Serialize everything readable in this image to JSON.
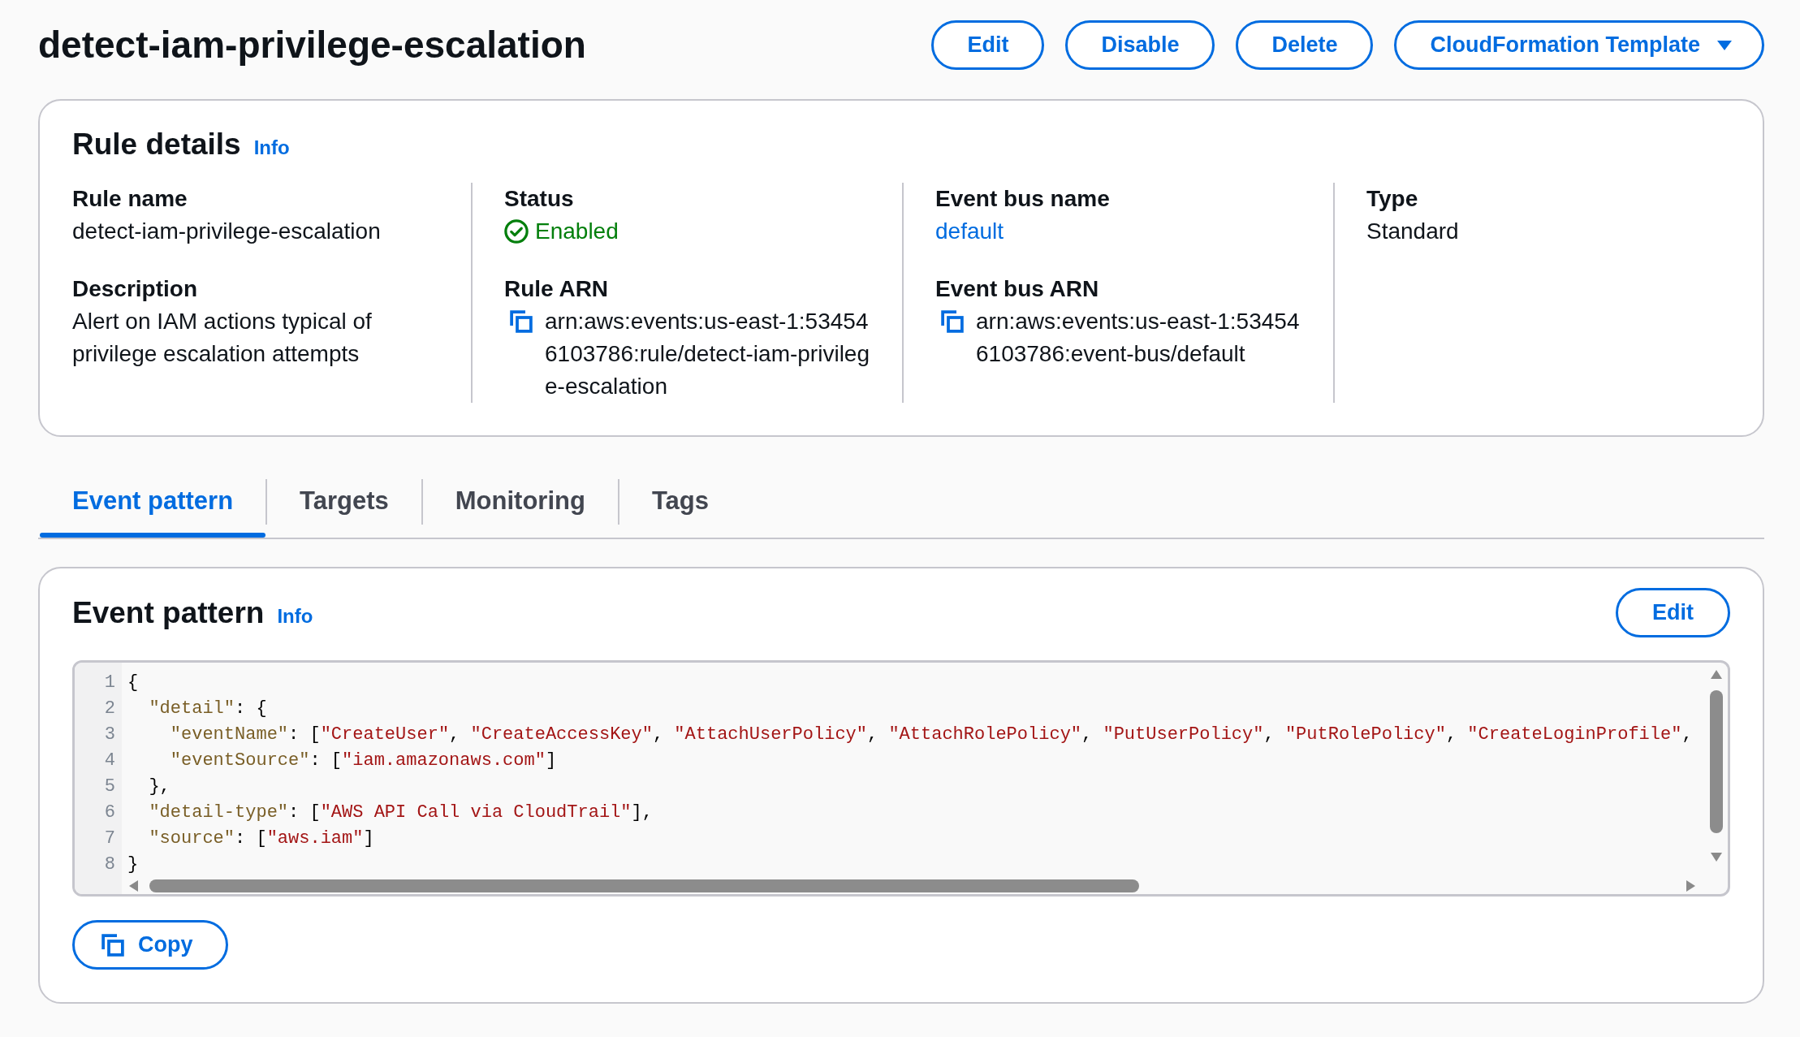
{
  "page": {
    "title": "detect-iam-privilege-escalation",
    "actions": [
      {
        "label": "Edit",
        "kind": "button"
      },
      {
        "label": "Disable",
        "kind": "button"
      },
      {
        "label": "Delete",
        "kind": "button"
      },
      {
        "label": "CloudFormation Template",
        "kind": "dropdown"
      }
    ]
  },
  "rule_details": {
    "heading": "Rule details",
    "info": "Info",
    "columns": [
      {
        "fields": [
          {
            "label": "Rule name",
            "value": "detect-iam-privilege-escalation",
            "kind": "text"
          },
          {
            "label": "Description",
            "value": "Alert on IAM actions typical of privilege escalation attempts",
            "kind": "text"
          }
        ]
      },
      {
        "fields": [
          {
            "label": "Status",
            "value": "Enabled",
            "kind": "status"
          },
          {
            "label": "Rule ARN",
            "value": "arn:aws:events:us-east-1:534546103786:rule/detect-iam-privilege-escalation",
            "kind": "copyable"
          }
        ]
      },
      {
        "fields": [
          {
            "label": "Event bus name",
            "value": "default",
            "kind": "link"
          },
          {
            "label": "Event bus ARN",
            "value": "arn:aws:events:us-east-1:534546103786:event-bus/default",
            "kind": "copyable"
          }
        ]
      },
      {
        "fields": [
          {
            "label": "Type",
            "value": "Standard",
            "kind": "text"
          }
        ]
      }
    ]
  },
  "tabs": [
    {
      "label": "Event pattern",
      "selected": true
    },
    {
      "label": "Targets",
      "selected": false
    },
    {
      "label": "Monitoring",
      "selected": false
    },
    {
      "label": "Tags",
      "selected": false
    }
  ],
  "event_pattern": {
    "heading": "Event pattern",
    "info": "Info",
    "edit_button": "Edit",
    "code_lines": [
      {
        "number": "1",
        "tokens": [
          {
            "kind": "punct",
            "text": "{"
          }
        ]
      },
      {
        "number": "2",
        "tokens": [
          {
            "kind": "key",
            "text": "  \"detail\""
          },
          {
            "kind": "punct",
            "text": ": {"
          }
        ]
      },
      {
        "number": "3",
        "tokens": [
          {
            "kind": "key",
            "text": "    \"eventName\""
          },
          {
            "kind": "punct",
            "text": ": ["
          },
          {
            "kind": "string",
            "text": "\"CreateUser\""
          },
          {
            "kind": "punct",
            "text": ", "
          },
          {
            "kind": "string",
            "text": "\"CreateAccessKey\""
          },
          {
            "kind": "punct",
            "text": ", "
          },
          {
            "kind": "string",
            "text": "\"AttachUserPolicy\""
          },
          {
            "kind": "punct",
            "text": ", "
          },
          {
            "kind": "string",
            "text": "\"AttachRolePolicy\""
          },
          {
            "kind": "punct",
            "text": ", "
          },
          {
            "kind": "string",
            "text": "\"PutUserPolicy\""
          },
          {
            "kind": "punct",
            "text": ", "
          },
          {
            "kind": "string",
            "text": "\"PutRolePolicy\""
          },
          {
            "kind": "punct",
            "text": ", "
          },
          {
            "kind": "string",
            "text": "\"CreateLoginProfile\""
          },
          {
            "kind": "punct",
            "text": ","
          }
        ]
      },
      {
        "number": "4",
        "tokens": [
          {
            "kind": "key",
            "text": "    \"eventSource\""
          },
          {
            "kind": "punct",
            "text": ": ["
          },
          {
            "kind": "string",
            "text": "\"iam.amazonaws.com\""
          },
          {
            "kind": "punct",
            "text": "]"
          }
        ]
      },
      {
        "number": "5",
        "tokens": [
          {
            "kind": "punct",
            "text": "  },"
          }
        ]
      },
      {
        "number": "6",
        "tokens": [
          {
            "kind": "key",
            "text": "  \"detail-type\""
          },
          {
            "kind": "punct",
            "text": ": ["
          },
          {
            "kind": "string",
            "text": "\"AWS API Call via CloudTrail\""
          },
          {
            "kind": "punct",
            "text": "],"
          }
        ]
      },
      {
        "number": "7",
        "tokens": [
          {
            "kind": "key",
            "text": "  \"source\""
          },
          {
            "kind": "punct",
            "text": ": ["
          },
          {
            "kind": "string",
            "text": "\"aws.iam\""
          },
          {
            "kind": "punct",
            "text": "]"
          }
        ]
      },
      {
        "number": "8",
        "tokens": [
          {
            "kind": "punct",
            "text": "}"
          }
        ]
      }
    ],
    "copy_button": "Copy"
  }
}
